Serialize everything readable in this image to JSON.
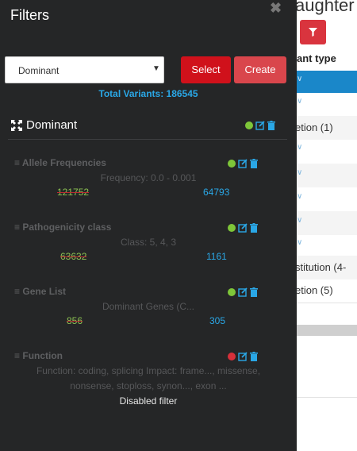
{
  "background": {
    "title_fragment": "aughter",
    "header_fragment": "ant type",
    "rows": [
      {
        "text": "etion (1)"
      },
      {
        "text": "stitution (4-"
      },
      {
        "text": "etion (5)"
      }
    ]
  },
  "panel": {
    "title": "Filters",
    "close_icon": "close-icon",
    "select": {
      "value": "Dominant"
    },
    "select_button": "Select",
    "create_button": "Create",
    "total_label": "Total Variants: 186545",
    "group": {
      "name": "Dominant",
      "icon": "expand-arrows-icon",
      "status": "green"
    },
    "filters": [
      {
        "name": "Allele Frequencies",
        "desc": "Frequency: 0.0 - 0.001",
        "before": "121752",
        "after": "64793",
        "status": "green"
      },
      {
        "name": "Pathogenicity class",
        "desc": "Class: 5, 4, 3",
        "before": "63632",
        "after": "1161",
        "status": "green"
      },
      {
        "name": "Gene List",
        "desc": "Dominant Genes (C...",
        "before": "856",
        "after": "305",
        "status": "green"
      },
      {
        "name": "Function",
        "desc_line1": "Function: coding, splicing Impact: frame..., missense,",
        "desc_line2": "nonsense, stoploss, synon..., exon ...",
        "disabled_text": "Disabled filter",
        "status": "red"
      }
    ]
  },
  "colors": {
    "accent_blue": "#2aa7e6",
    "green": "#7ec639",
    "red": "#d6303a",
    "panel_bg": "#252627"
  }
}
